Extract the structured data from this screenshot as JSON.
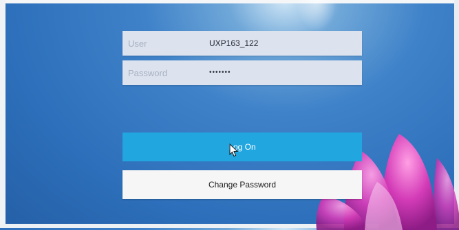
{
  "login_form": {
    "user": {
      "label": "User",
      "value": "UXP163_122"
    },
    "password": {
      "label": "Password",
      "value": "•••••••"
    }
  },
  "buttons": {
    "logon_label": "Log On",
    "change_password_label": "Change Password"
  },
  "colors": {
    "logon_button": "#21a6df",
    "field_background": "#dce2ee",
    "background": "#2d6fba",
    "flower": "#d43cb8"
  },
  "icons": {
    "cursor": "mouse-pointer-icon"
  }
}
